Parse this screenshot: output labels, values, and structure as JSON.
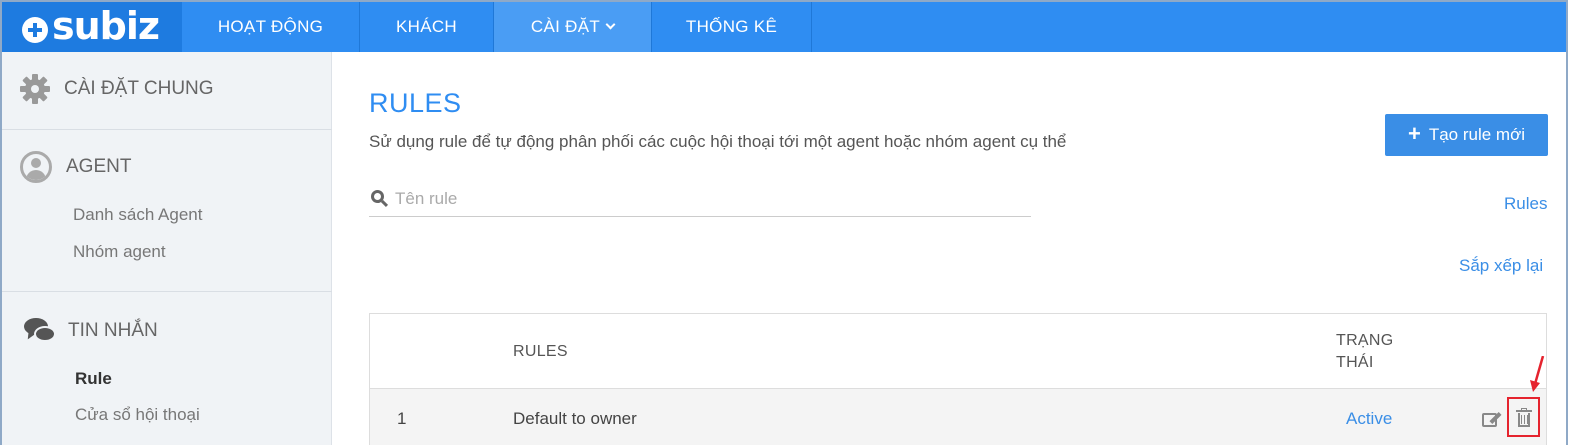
{
  "topnav": {
    "logo_text": "subiz",
    "items": [
      {
        "label": "HOẠT ĐỘNG"
      },
      {
        "label": "KHÁCH"
      },
      {
        "label": "CÀI ĐẶT",
        "active": true
      },
      {
        "label": "THỐNG KÊ"
      }
    ]
  },
  "sidebar": {
    "general": {
      "label": "CÀI ĐẶT CHUNG",
      "icon": "gear-icon"
    },
    "agent": {
      "label": "AGENT",
      "icon": "user-icon",
      "items": [
        {
          "label": "Danh sách Agent"
        },
        {
          "label": "Nhóm agent"
        }
      ]
    },
    "messages": {
      "label": "TIN NHẮN",
      "icon": "chat-icon",
      "items": [
        {
          "label": "Rule",
          "active": true
        },
        {
          "label": "Cửa sổ hội thoại"
        }
      ]
    }
  },
  "main": {
    "title": "RULES",
    "description": "Sử dụng rule để tự động phân phối các cuộc hội thoại tới một agent hoặc nhóm agent cụ thể",
    "create_button": "Tạo rule mới",
    "search": {
      "placeholder": "Tên rule",
      "value": ""
    },
    "rules_link": "Rules",
    "sort_link": "Sắp xếp lại",
    "table": {
      "headers": {
        "rules": "RULES",
        "status_line1": "TRẠNG",
        "status_line2": "THÁI"
      },
      "rows": [
        {
          "index": "1",
          "name": "Default to owner",
          "status": "Active"
        }
      ]
    }
  },
  "colors": {
    "nav_bg": "#2f8df2",
    "accent": "#3a8ee6",
    "highlight": "#e5232e"
  }
}
